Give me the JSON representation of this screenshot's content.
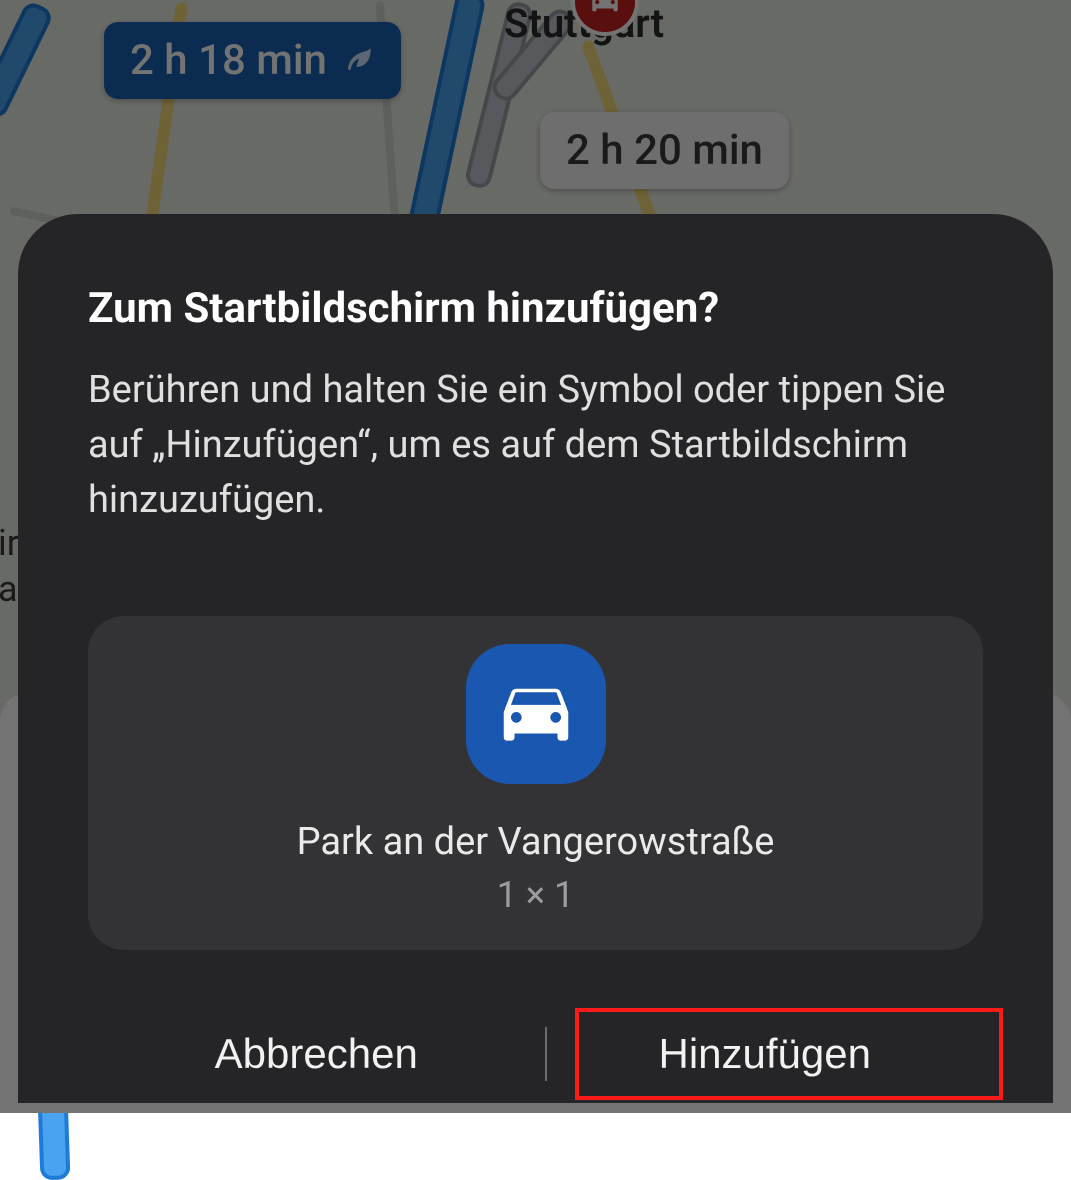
{
  "map": {
    "city_label": "Stuttgart",
    "route_primary_badge": "2 h 18 min",
    "route_primary_icon": "leaf-icon",
    "route_secondary_badge": "2 h 20 min",
    "dest_pin_icon": "car-icon",
    "edge_text_top": "ir",
    "edge_text_bottom": "au"
  },
  "dialog": {
    "title": "Zum Startbildschirm hinzufügen?",
    "description": "Berühren und halten Sie ein Symbol oder tippen Sie auf „Hinzufügen“, um es auf dem Startbildschirm hinzuzufügen.",
    "preview": {
      "icon": "car-icon",
      "name": "Park an der Vangerowstraße",
      "size": "1 × 1"
    },
    "actions": {
      "cancel": "Abbrechen",
      "confirm": "Hinzufügen"
    }
  },
  "colors": {
    "accent_route": "#1a5fb4",
    "dialog_bg": "#252527",
    "icon_bg": "#1a57b0",
    "highlight": "#ff1a1a"
  }
}
